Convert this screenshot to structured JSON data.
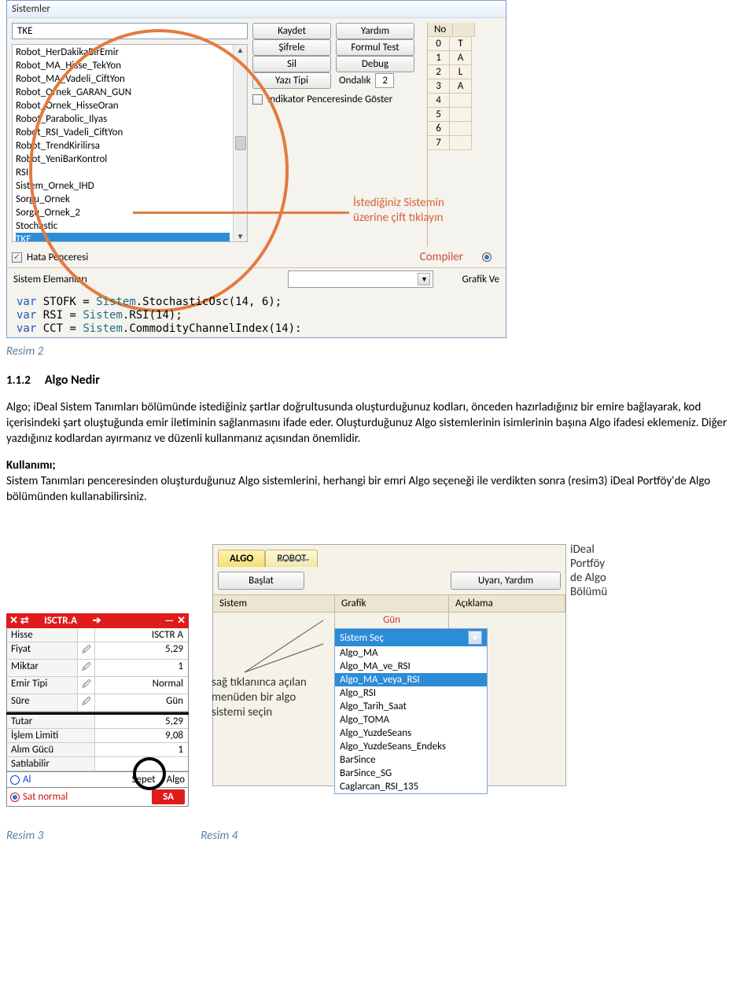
{
  "window1": {
    "title": "Sistemler",
    "topCell": "TKE",
    "list": [
      "Robot_HerDakikaBirEmir",
      "Robot_MA_Hisse_TekYon",
      "Robot_MA_Vadeli_CiftYon",
      "Robot_Ornek_GARAN_GUN",
      "Robot_Ornek_HisseOran",
      "Robot_Parabolic_Ilyas",
      "Robot_RSI_Vadeli_CiftYon",
      "Robot_TrendKirilirsa",
      "Robot_YeniBarKontrol",
      "RSI",
      "Sistem_Ornek_IHD",
      "Sorgu_Ornek",
      "Sorgu_Ornek_2",
      "Stochastic",
      "TKE"
    ],
    "selectedIndex": 14,
    "buttons": {
      "kaydet": "Kaydet",
      "yardim": "Yardım",
      "sifrele": "Şifrele",
      "formul": "Formul Test",
      "sil": "Sil",
      "debug": "Debug",
      "yazi": "Yazı Tipi"
    },
    "ondalikLabel": "Ondalık",
    "ondalikValue": "2",
    "indikatorLabel": "Indikator Penceresinde Göster",
    "indikatorChecked": false,
    "hataLabel": "Hata Penceresi",
    "hataChecked": true,
    "compilerLabel": "Compiler",
    "sistemElemLabel": "Sistem Elemanları",
    "grafikVeLabel": "Grafik Ve",
    "gridHeader": "No",
    "gridNums": [
      "0",
      "1",
      "2",
      "3",
      "4",
      "5",
      "6",
      "7"
    ],
    "gridLetters": [
      "T",
      "A",
      "L",
      "A",
      "",
      "",
      "",
      ""
    ],
    "annotation": "İstediğiniz Sistemin\nüzerine çift tıklayın",
    "code1_pre": "var ",
    "code1_a": "STOFK",
    "code1_b": " = ",
    "code1_c": "Sistem",
    "code1_d": ".StochasticOsc(14, 6);",
    "code2_a": "RSI",
    "code2_b": " = ",
    "code2_c": "Sistem",
    "code2_d": ".RSI(14);",
    "code3_a": "CCT",
    "code3_b": " = ",
    "code3_c": "Sistem",
    "code3_d": ".CommodityChannelIndex(14):"
  },
  "caption1": "Resim 2",
  "section": {
    "num": "1.1.2",
    "head": "Algo Nedir",
    "p1": "Algo; iDeal Sistem Tanımları bölümünde istediğiniz şartlar doğrultusunda oluşturduğunuz kodları, önceden hazırladığınız bir emire bağlayarak, kod içerisindeki şart oluştuğunda emir iletiminin sağlanmasını ifade eder. Oluşturduğunuz Algo sistemlerinin isimlerinin başına Algo ifadesi eklemeniz. Diğer yazdığınız kodlardan ayırmanız ve düzenli kullanmanız açısından önemlidir.",
    "p2h": "Kullanımı;",
    "p2": "Sistem Tanımları penceresinden oluşturduğunuz Algo sistemlerini, herhangi bir emri Algo seçeneği ile verdikten sonra (resim3) iDeal Portföy'de Algo bölümünden kullanabilirsiniz."
  },
  "panel": {
    "barL": "✕ ⇄",
    "barTitle": "ISCTR.A",
    "barArrow": "➔",
    "barR1": "—",
    "barR2": "✕",
    "rows": [
      {
        "l": "Hisse",
        "v": "ISCTR A",
        "ic": ""
      },
      {
        "l": "Fiyat",
        "v": "5,29",
        "ic": "🖉"
      },
      {
        "l": "Miktar",
        "v": "1",
        "ic": "🖉"
      },
      {
        "l": "Emir Tipi",
        "v": "Normal",
        "ic": "🖉"
      },
      {
        "l": "Süre",
        "v": "Gün",
        "ic": "🖉"
      }
    ],
    "rows2": [
      {
        "l": "Tutar",
        "v": "5,29"
      },
      {
        "l": "İşlem Limiti",
        "v": "9,08"
      },
      {
        "l": "Alım Gücü",
        "v": "1"
      },
      {
        "l": "Satılabilir",
        "v": ""
      }
    ],
    "al": "Al",
    "sat": "Sat normal",
    "sepet": "Sepet",
    "algo": "Algo",
    "satbtn": "SA"
  },
  "annot2": "sağ tıklanınca açılan menüden bir algo sistemi seçin",
  "annot3": "iDeal Portföy de Algo Bölümü",
  "win2": {
    "tab1": "ALGO",
    "tab2": "ROBOT",
    "btn1": "Başlat",
    "btn2": "Uyarı, Yardım",
    "headers": [
      "Sistem",
      "Grafik",
      "Açıklama"
    ],
    "gun": "Gün",
    "selHead": "Sistem Seç",
    "opts": [
      "Algo_MA",
      "Algo_MA_ve_RSI",
      "Algo_MA_veya_RSI",
      "Algo_RSI",
      "Algo_Tarih_Saat",
      "Algo_TOMA",
      "Algo_YuzdeSeans",
      "Algo_YuzdeSeans_Endeks",
      "BarSince",
      "BarSince_SG",
      "Caglarcan_RSI_135"
    ],
    "optSel": 2
  },
  "caption3": "Resim 3",
  "caption4": "Resim 4"
}
